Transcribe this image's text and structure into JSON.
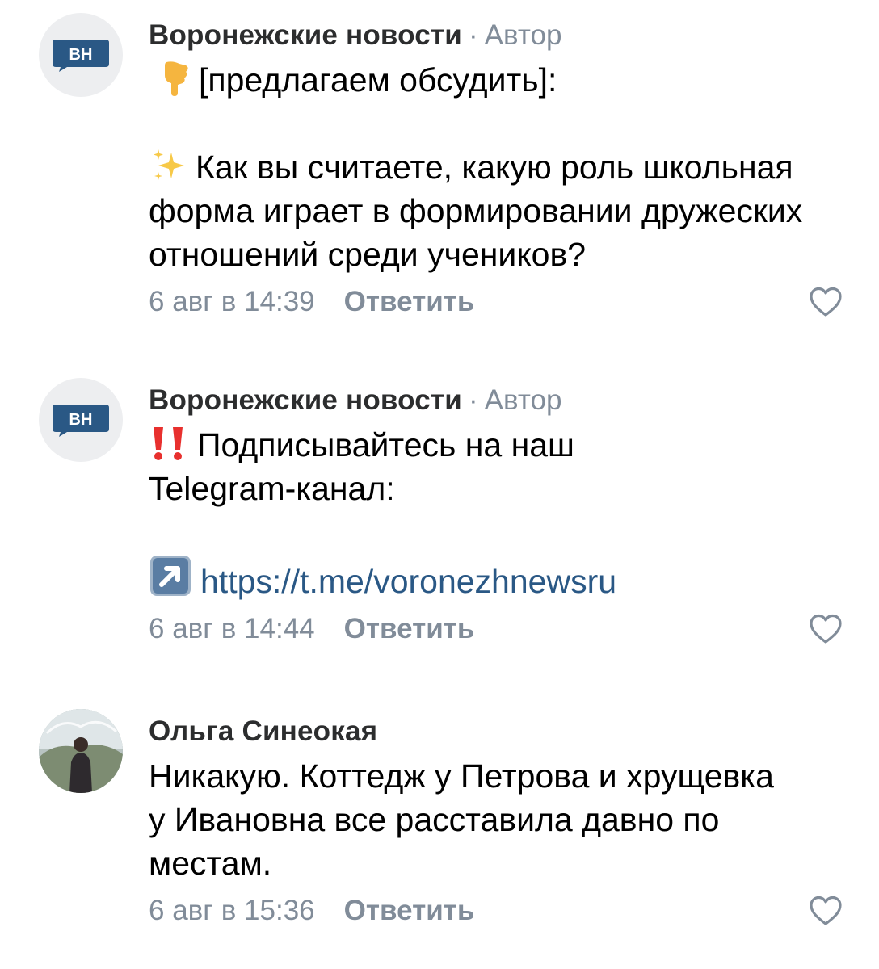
{
  "comments": [
    {
      "author": "Воронежские новости",
      "separator": "·",
      "badge": "Автор",
      "avatar_text": "ВН",
      "lines": {
        "l1": "[предлагаем обсудить]:",
        "l2": "Как вы считаете, какую роль школьная",
        "l3": "форма играет в формировании дружеских",
        "l4": "отношений среди учеников?"
      },
      "icons": {
        "first": "point-down-emoji",
        "second": "sparkles-emoji"
      },
      "time": "6 авг в 14:39",
      "reply": "Ответить"
    },
    {
      "author": "Воронежские новости",
      "separator": "·",
      "badge": "Автор",
      "avatar_text": "ВН",
      "lines": {
        "l1": "Подписывайтесь на наш",
        "l2": "Telegram-канал:",
        "link": "https://t.me/voronezhnewsru"
      },
      "icons": {
        "first": "double-exclamation-emoji",
        "second": "up-right-arrow-emoji"
      },
      "time": "6 авг в 14:44",
      "reply": "Ответить"
    },
    {
      "author": "Ольга Синеокая",
      "lines": {
        "l1": "Никакую. Коттедж у Петрова и хрущевка",
        "l2": "у Ивановна все расставила давно по",
        "l3": "местам."
      },
      "time": "6 авг в 15:36",
      "reply": "Ответить"
    }
  ],
  "colors": {
    "brand_blue": "#2a5885",
    "meta_gray": "#818c99",
    "avatar_bg": "#edeef0"
  }
}
